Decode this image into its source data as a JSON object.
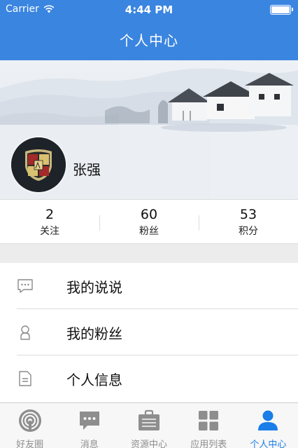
{
  "status_bar": {
    "carrier": "Carrier",
    "time": "4:44 PM"
  },
  "nav": {
    "title": "个人中心"
  },
  "profile": {
    "name": "张强"
  },
  "stats": [
    {
      "value": "2",
      "label": "关注"
    },
    {
      "value": "60",
      "label": "粉丝"
    },
    {
      "value": "53",
      "label": "积分"
    }
  ],
  "menu": [
    {
      "label": "我的说说",
      "icon": "chat-bubble-icon"
    },
    {
      "label": "我的粉丝",
      "icon": "person-icon"
    },
    {
      "label": "个人信息",
      "icon": "document-icon"
    }
  ],
  "tabs": [
    {
      "label": "好友圈",
      "icon": "broadcast-icon",
      "active": false
    },
    {
      "label": "消息",
      "icon": "message-icon",
      "active": false
    },
    {
      "label": "资源中心",
      "icon": "briefcase-icon",
      "active": false
    },
    {
      "label": "应用列表",
      "icon": "grid-icon",
      "active": false
    },
    {
      "label": "个人中心",
      "icon": "user-icon",
      "active": true
    }
  ],
  "colors": {
    "primary": "#3a85e0",
    "active_tab": "#1a7de8",
    "inactive_tab": "#8e8e8e"
  }
}
